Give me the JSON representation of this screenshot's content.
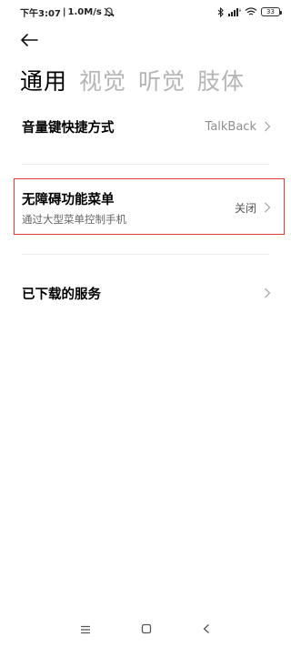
{
  "status_bar": {
    "time": "下午3:07",
    "separator": "|",
    "net_speed": "1.0M/s",
    "battery_level": "33",
    "icons": [
      "mute-icon",
      "bluetooth-icon",
      "signal-icon",
      "wifi-icon",
      "battery-icon"
    ]
  },
  "header": {
    "back_icon": "arrow-left-icon"
  },
  "tabs": [
    {
      "label": "通用",
      "active": true
    },
    {
      "label": "视觉",
      "active": false
    },
    {
      "label": "听觉",
      "active": false
    },
    {
      "label": "肢体",
      "active": false
    }
  ],
  "settings": {
    "volume_shortcut": {
      "title": "音量键快捷方式",
      "value": "TalkBack"
    },
    "accessibility_menu": {
      "title": "无障碍功能菜单",
      "subtitle": "通过大型菜单控制手机",
      "value": "关闭"
    },
    "downloaded_services": {
      "title": "已下载的服务"
    }
  },
  "nav_bar": {
    "icons": [
      "menu-icon",
      "home-icon",
      "back-icon"
    ]
  },
  "colors": {
    "highlight_border": "#e8383d",
    "inactive_tab": "#b5b5b5",
    "secondary_text": "#8f8f8f"
  }
}
